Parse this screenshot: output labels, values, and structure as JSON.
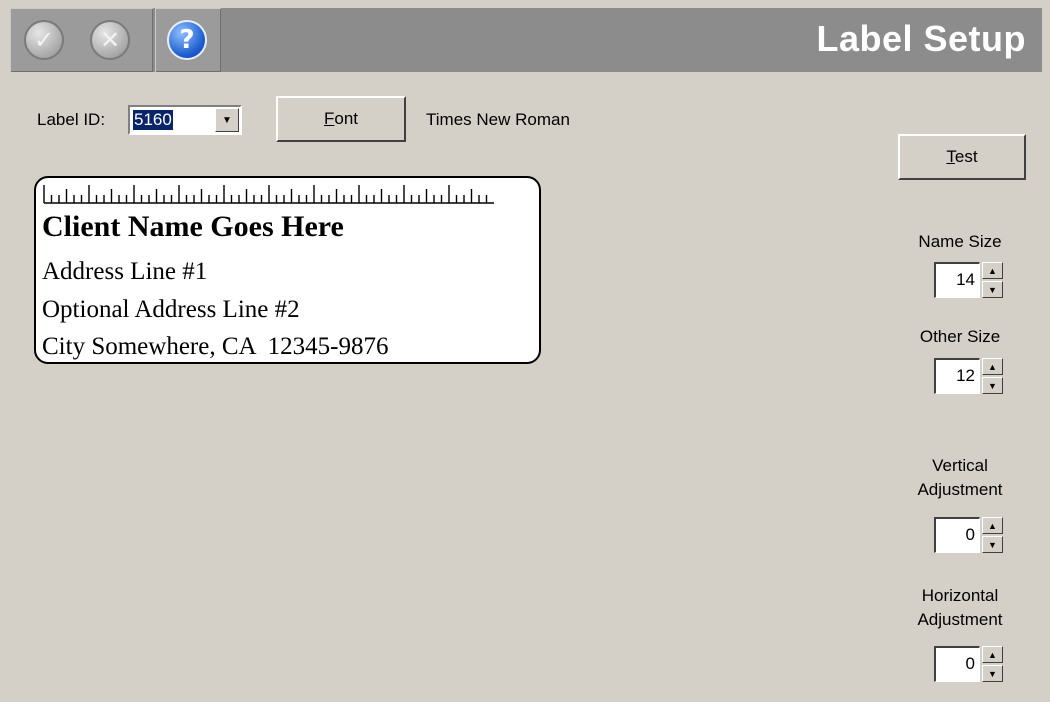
{
  "window": {
    "title": "Label Setup",
    "toolbar": [
      {
        "icon": "check-circle-icon",
        "glyph": "✓",
        "enabled": false
      },
      {
        "icon": "cancel-circle-icon",
        "glyph": "✕",
        "enabled": false
      },
      {
        "icon": "help-icon",
        "glyph": "?",
        "enabled": true
      }
    ]
  },
  "label_id": {
    "label": "Label ID:",
    "value": "5160"
  },
  "font": {
    "button_prefix": "",
    "button_access": "F",
    "button_rest": "ont",
    "current_font": "Times New Roman"
  },
  "test_button": {
    "access": "T",
    "rest": "est"
  },
  "preview": {
    "name": "Client Name Goes Here",
    "address1": "Address Line #1",
    "address2": "Optional Address Line #2",
    "city_line": "City Somewhere, CA  12345-9876"
  },
  "settings": {
    "name_size": {
      "label": "Name Size",
      "value": "14"
    },
    "other_size": {
      "label": "Other Size",
      "value": "12"
    },
    "vertical": {
      "label_line1": "Vertical",
      "label_line2": "Adjustment",
      "value": "0"
    },
    "horizontal": {
      "label_line1": "Horizontal",
      "label_line2": "Adjustment",
      "value": "0"
    }
  }
}
